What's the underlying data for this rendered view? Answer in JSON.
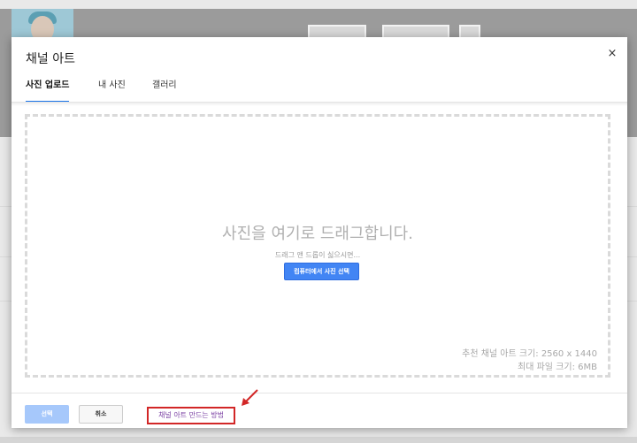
{
  "dialog": {
    "title": "채널 아트",
    "close_glyph": "×",
    "tabs": [
      {
        "label": "사진 업로드",
        "active": true
      },
      {
        "label": "내 사진",
        "active": false
      },
      {
        "label": "갤러리",
        "active": false
      }
    ],
    "drop_zone": {
      "title": "사진을 여기로 드래그합니다.",
      "subtitle": "드래그 앤 드롭이 싫으시면...",
      "button_label": "컴퓨터에서 사진 선택",
      "recommended_size": "추천 채널 아트 크기: 2560 x 1440",
      "max_file_size": "최대 파일 크기: 6MB"
    },
    "footer": {
      "select_label": "선택",
      "cancel_label": "취소",
      "help_link": "채널 아트 만드는 방법"
    }
  },
  "colors": {
    "accent": "#4285f4",
    "tab_underline": "#1a73e8",
    "select_disabled": "#a6c8fb",
    "highlight_box": "#d22727",
    "link": "#7a3fa3"
  },
  "icons": [
    "close-icon",
    "arrow-icon"
  ]
}
